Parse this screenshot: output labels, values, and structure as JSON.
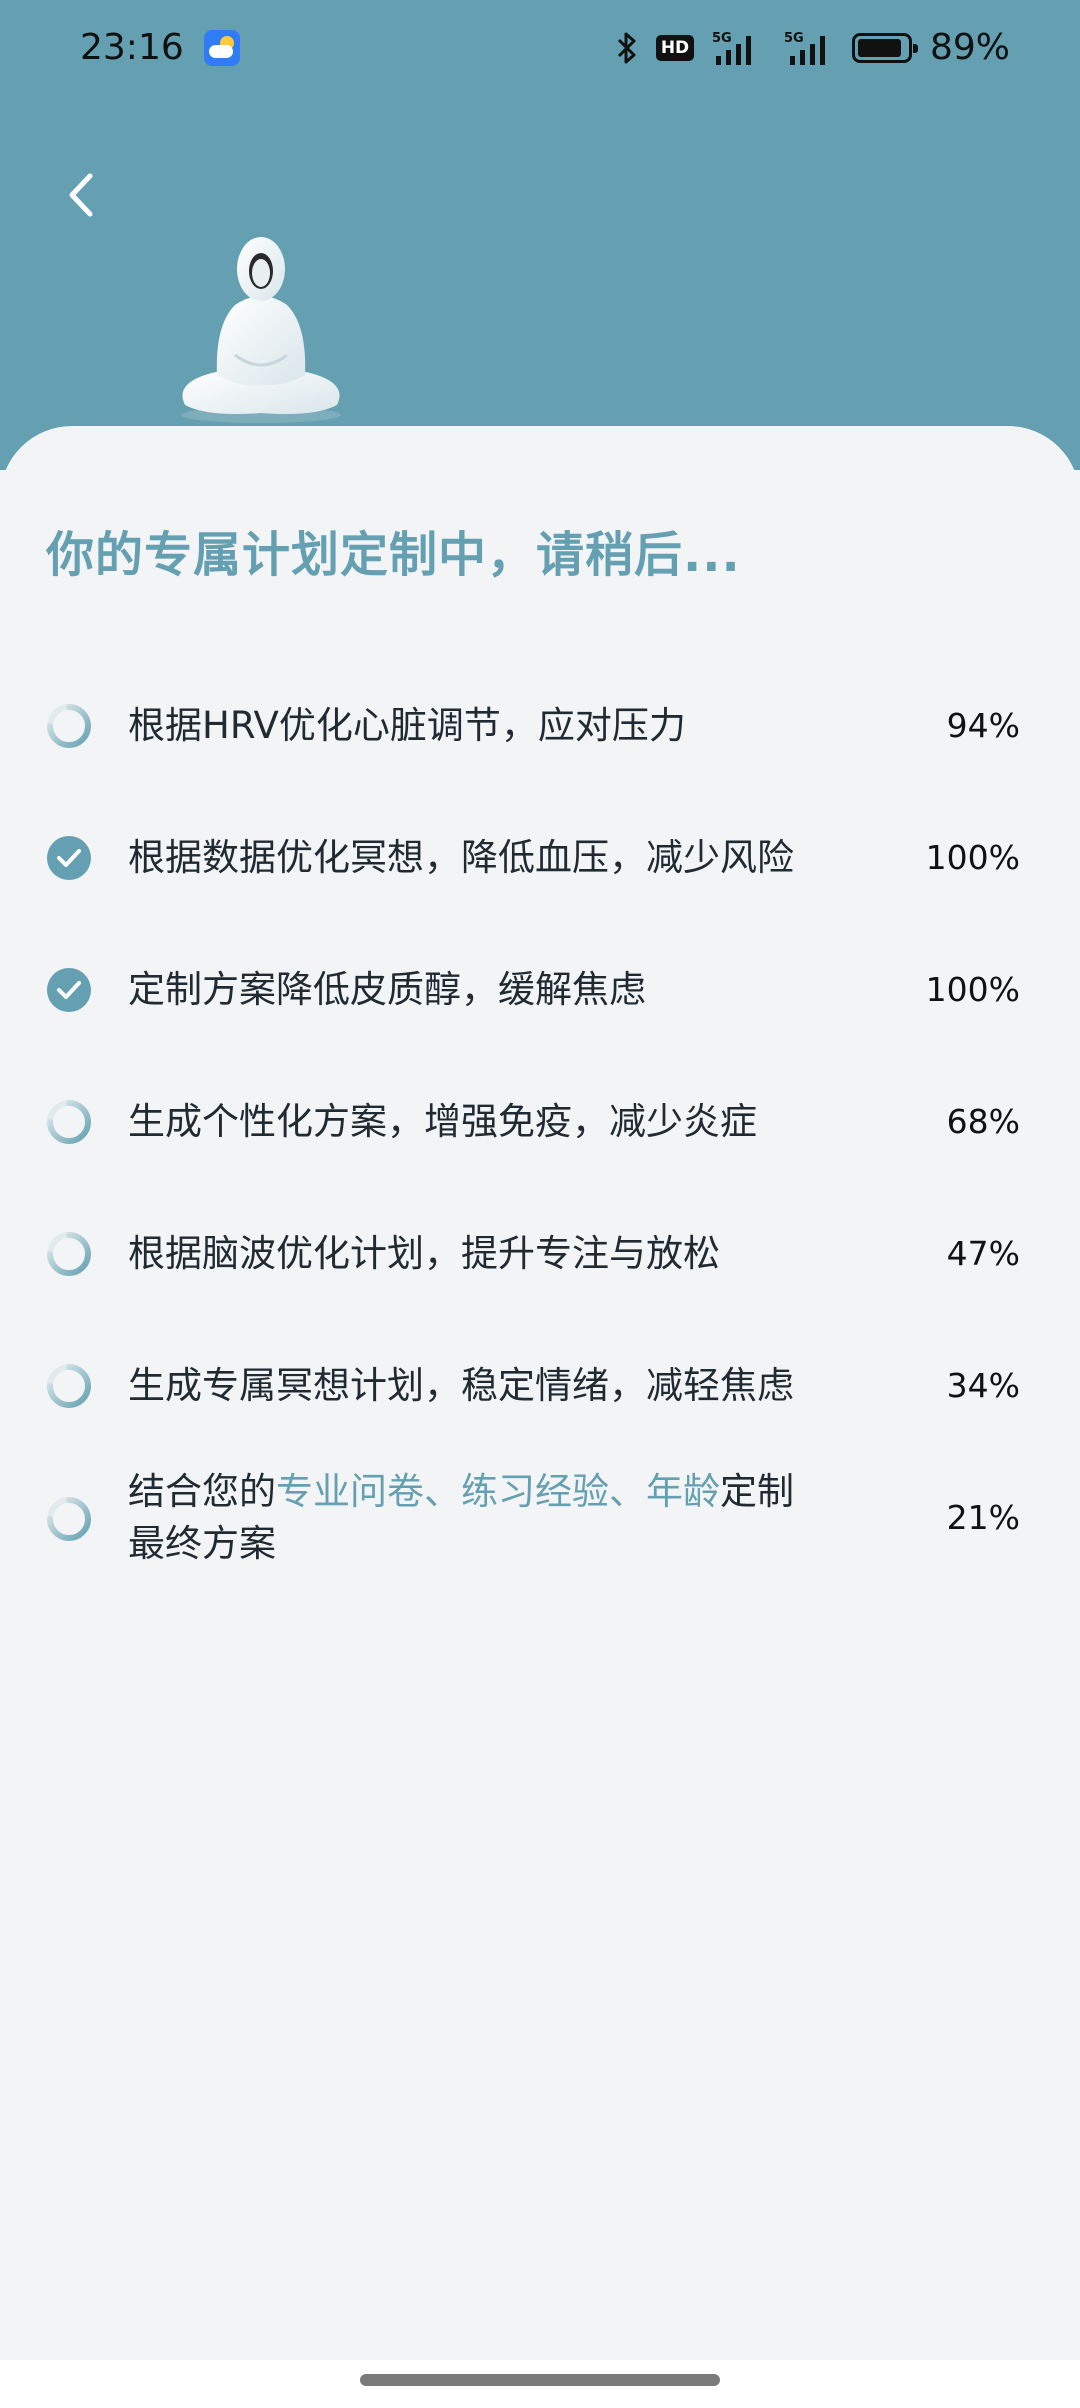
{
  "status_bar": {
    "time": "23:16",
    "weather_icon": "weather-partly-cloudy-icon",
    "hd_label": "HD",
    "signal_1_label": "5G",
    "signal_2_label": "5G",
    "battery_percent": 89,
    "battery_text": "89%"
  },
  "header": {
    "back_icon": "chevron-left-icon",
    "illustration": "meditating-figure"
  },
  "title": "你的专属计划定制中，请稍后...",
  "colors": {
    "accent": "#64A0B1",
    "header_bg": "#64A0B1",
    "card_bg": "#F3F4F6",
    "text": "#1F2A33"
  },
  "tasks": [
    {
      "status": "loading",
      "label": "根据HRV优化心脏调节，应对压力",
      "percent": "94%"
    },
    {
      "status": "done",
      "label": "根据数据优化冥想，降低血压，减少风险",
      "percent": "100%"
    },
    {
      "status": "done",
      "label": "定制方案降低皮质醇，缓解焦虑",
      "percent": "100%"
    },
    {
      "status": "loading",
      "label": "生成个性化方案，增强免疫，减少炎症",
      "percent": "68%"
    },
    {
      "status": "loading",
      "label": "根据脑波优化计划，提升专注与放松",
      "percent": "47%"
    },
    {
      "status": "loading",
      "label": "生成专属冥想计划，稳定情绪，减轻焦虑",
      "percent": "34%"
    },
    {
      "status": "loading",
      "label_parts": {
        "prefix": "结合您的",
        "highlight": "专业问卷、练习经验、年龄",
        "suffix_line1": "定制",
        "line2": "最终方案"
      },
      "percent": "21%"
    }
  ]
}
